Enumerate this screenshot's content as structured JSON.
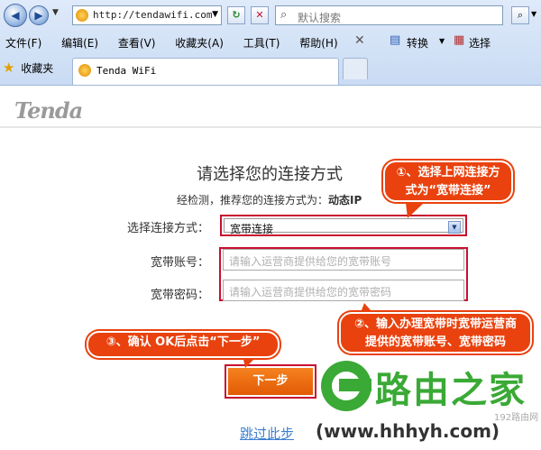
{
  "browser": {
    "address": "http://tendawifi.com",
    "search_placeholder": "默认搜索",
    "menu": [
      "文件(F)",
      "编辑(E)",
      "查看(V)",
      "收藏夹(A)",
      "工具(T)",
      "帮助(H)"
    ],
    "convert_label": "转换",
    "select_label": "选择",
    "favorites_label": "收藏夹",
    "tab_title": "Tenda WiFi"
  },
  "page": {
    "logo": "Tenda",
    "title": "请选择您的连接方式",
    "detected_prefix": "经检测，推荐您的连接方式为：",
    "detected_value": "动态IP",
    "connection_label": "选择连接方式：",
    "connection_value": "宽带连接",
    "account_label": "宽带账号：",
    "account_placeholder": "请输入运营商提供给您的宽带账号",
    "password_label": "宽带密码：",
    "password_placeholder": "请输入运营商提供给您的宽带密码",
    "next_button": "下一步",
    "skip_link": "跳过此步"
  },
  "callouts": {
    "c1_line1": "①、选择上网连接方",
    "c1_line2": "式为“宽带连接”",
    "c2_line1": "②、输入办理宽带时宽带运营商",
    "c2_line2": "提供的宽带账号、宽带密码",
    "c3": "③、确认 OK后点击“下一步”"
  },
  "watermark": {
    "brand": "路由之家",
    "url": "(www.hhhyh.com)",
    "small": "192路由网"
  },
  "colors": {
    "accent_orange": "#e9420e",
    "button_orange": "#ee6a0a",
    "highlight_red": "#c8102e",
    "watermark_green": "#3aa935"
  }
}
